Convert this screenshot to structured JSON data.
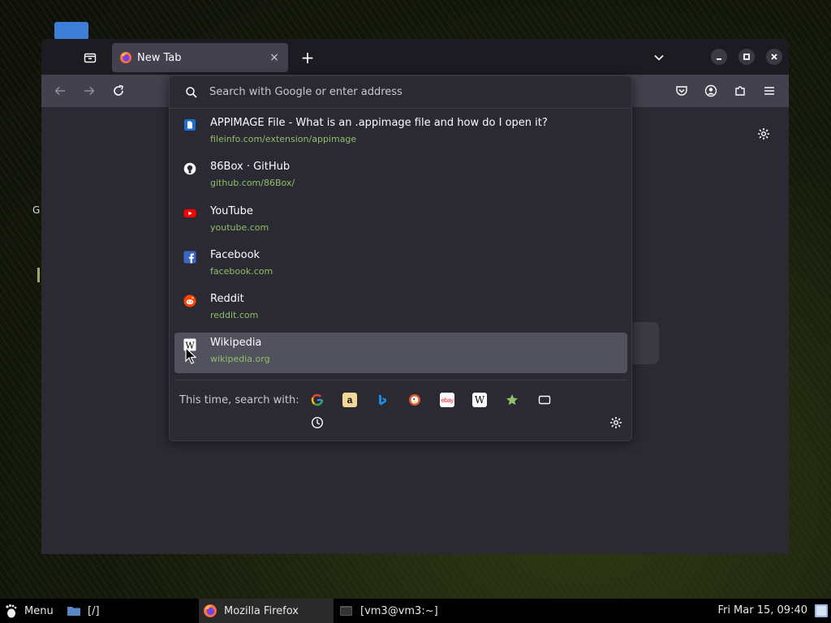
{
  "browser": {
    "tab": {
      "title": "New Tab",
      "close_glyph": "×"
    },
    "new_tab_glyph": "+",
    "colors": {
      "accent": "#0060df",
      "url_green": "#8fbf6a",
      "panel": "#2b2a33",
      "toolbar": "#42414d"
    }
  },
  "urlbar": {
    "placeholder": "Search with Google or enter address",
    "results": [
      {
        "title": "APPIMAGE File - What is an .appimage file and how do I open it?",
        "url": "fileinfo.com/extension/appimage",
        "icon": "document-icon"
      },
      {
        "title": "86Box · GitHub",
        "url": "github.com/86Box/",
        "icon": "github-icon"
      },
      {
        "title": "YouTube",
        "url": "youtube.com",
        "icon": "youtube-icon"
      },
      {
        "title": "Facebook",
        "url": "facebook.com",
        "icon": "facebook-icon"
      },
      {
        "title": "Reddit",
        "url": "reddit.com",
        "icon": "reddit-icon"
      },
      {
        "title": "Wikipedia",
        "url": "wikipedia.org",
        "icon": "wikipedia-icon"
      }
    ],
    "one_off_label": "This time, search with:",
    "engines": [
      "google-icon",
      "amazon-icon",
      "bing-icon",
      "duckduckgo-icon",
      "ebay-icon",
      "wikipedia-icon",
      "bookmarks-icon",
      "tabs-icon",
      "history-icon"
    ],
    "engine_texts": {
      "amazon": "a",
      "ebay": "ebay",
      "wikipedia": "W"
    }
  },
  "desktop": {
    "side_letter": "G"
  },
  "taskbar": {
    "menu_label": "Menu",
    "files_label": "[/]",
    "firefox_label": "Mozilla Firefox",
    "terminal_label": "[vm3@vm3:~]",
    "clock": "Fri Mar 15, 09:40"
  }
}
